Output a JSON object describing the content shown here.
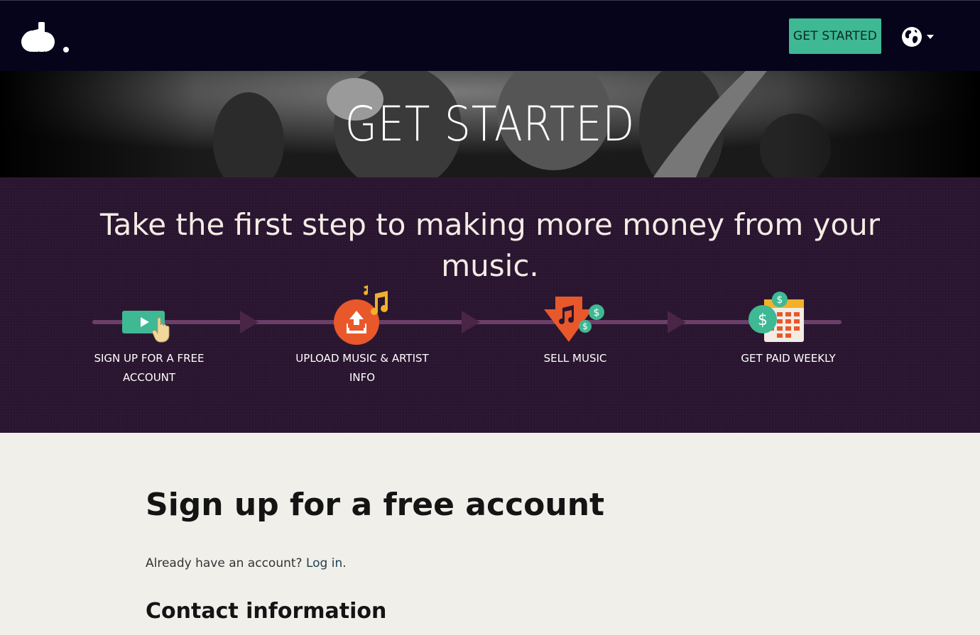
{
  "header": {
    "logo_alt": "cdb.",
    "cta_label": "GET STARTED",
    "language_icon": "globe-icon"
  },
  "hero": {
    "title": "GET STARTED"
  },
  "steps_section": {
    "tagline": "Take the first step to making more money from your music.",
    "steps": [
      {
        "label": "SIGN UP FOR A FREE ACCOUNT",
        "icon": "signup-screen-icon"
      },
      {
        "label": "UPLOAD MUSIC & ARTIST INFO",
        "icon": "upload-music-icon"
      },
      {
        "label": "SELL MUSIC",
        "icon": "sell-music-icon"
      },
      {
        "label": "GET PAID WEEKLY",
        "icon": "calendar-money-icon"
      }
    ]
  },
  "signup": {
    "title": "Sign up for a free account",
    "already_text": "Already have an account?",
    "login_label": "Log in",
    "already_suffix": ".",
    "contact_heading": "Contact information"
  },
  "colors": {
    "header_bg": "#05041a",
    "accent_green": "#3fb894",
    "band_bg": "#2a1530",
    "timeline": "#6a3f69",
    "orange": "#e8582a",
    "page_bg": "#f1efea"
  }
}
